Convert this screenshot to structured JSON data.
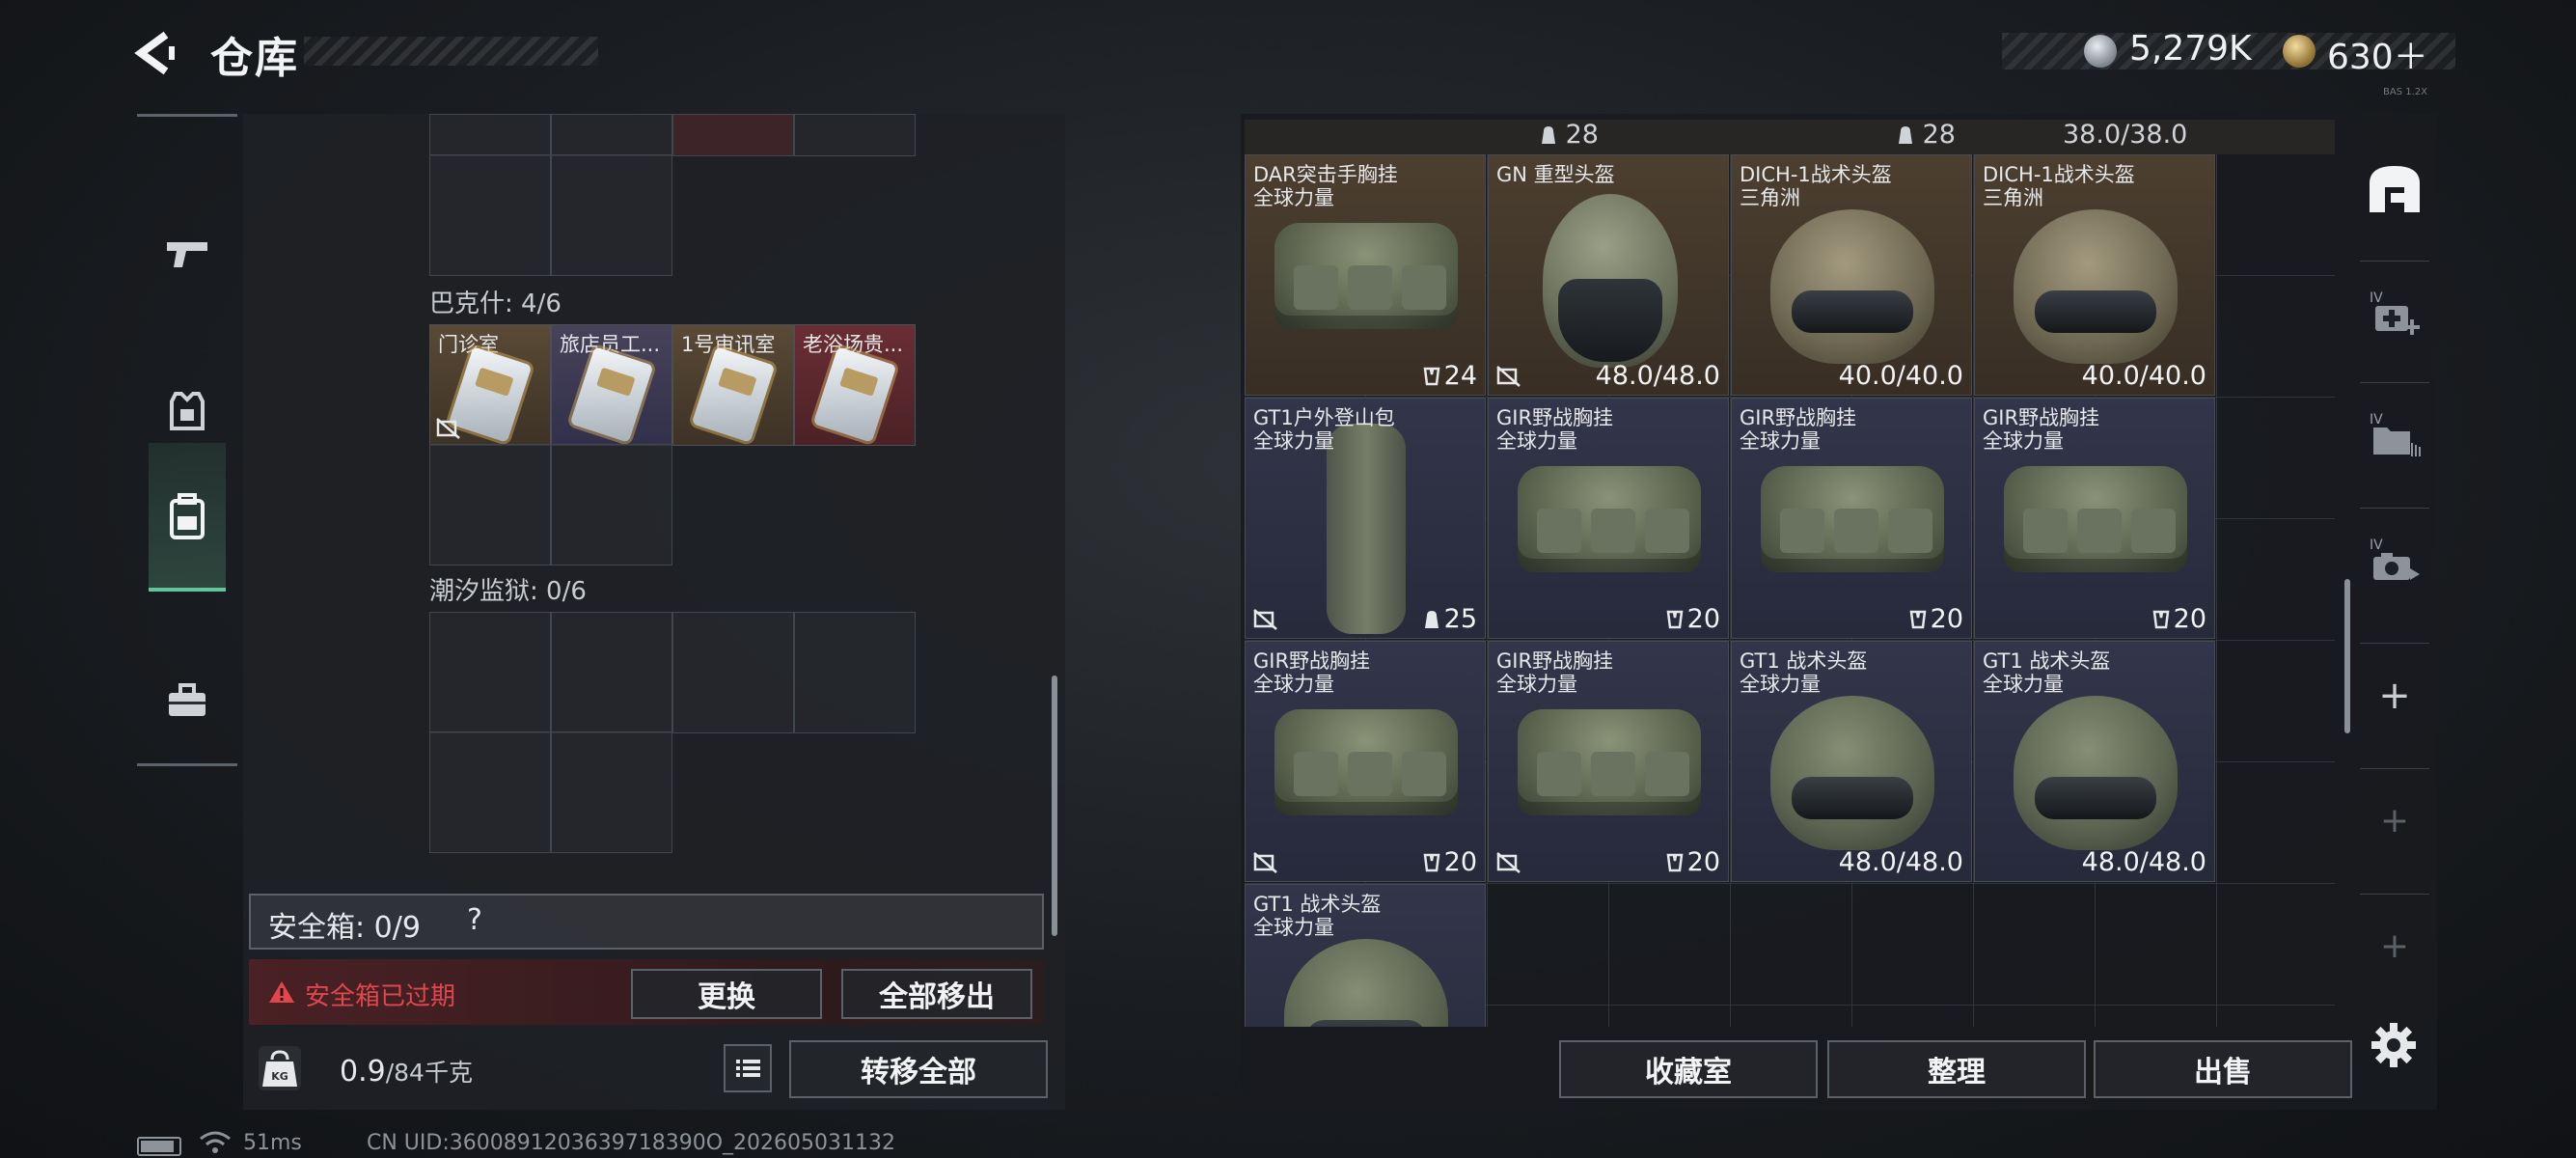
{
  "header": {
    "title": "仓库",
    "currency_silver": "5,279K",
    "currency_gold": "630＋",
    "version_tag": "BAS 1.2X"
  },
  "left_nav": {
    "items": [
      {
        "icon": "pistol-icon"
      },
      {
        "icon": "armor-vest-icon"
      },
      {
        "icon": "backpack-icon",
        "active": true
      },
      {
        "icon": "toolbox-icon"
      }
    ]
  },
  "key_sections": {
    "baksh": {
      "label": "巴克什: 4/6"
    },
    "tide_prison": {
      "label": "潮汐监狱: 0/6"
    }
  },
  "key_cards": [
    {
      "label": "门诊室",
      "tier": "brown"
    },
    {
      "label": "旅店员工...",
      "tier": "purple"
    },
    {
      "label": "1号审讯室",
      "tier": "brown"
    },
    {
      "label": "老浴场贵...",
      "tier": "red"
    }
  ],
  "safebox": {
    "label": "安全箱: 0/9",
    "help": "?",
    "expired_text": "安全箱已过期",
    "replace_label": "更换",
    "remove_all_label": "全部移出"
  },
  "footer_left": {
    "weight_value": "0.9",
    "weight_unit": "/84千克",
    "transfer_all_label": "转移全部"
  },
  "inventory": {
    "top_partial": [
      "28",
      "28",
      "38.0/38.0"
    ],
    "items": [
      {
        "name": "DAR突击手胸挂",
        "sub": "全球力量",
        "value": "24",
        "value_icon": "durability-icon",
        "tier": "brown",
        "pic": "bag"
      },
      {
        "name": "GN 重型头盔",
        "sub": "",
        "value": "48.0/48.0",
        "tier": "brown",
        "pic": "gn",
        "noimport": true
      },
      {
        "name": "DICH-1战术头盔",
        "sub": "三角洲",
        "value": "40.0/40.0",
        "tier": "brown",
        "pic": "helmet"
      },
      {
        "name": "DICH-1战术头盔",
        "sub": "三角洲",
        "value": "40.0/40.0",
        "tier": "brown",
        "pic": "helmet"
      },
      {
        "name": "GT1户外登山包",
        "sub": "全球力量",
        "value": "25",
        "value_icon": "capacity-icon",
        "tier": "blue",
        "pic": "backpack",
        "noimport": true
      },
      {
        "name": "GIR野战胸挂",
        "sub": "全球力量",
        "value": "20",
        "value_icon": "durability-icon",
        "tier": "blue",
        "pic": "bag"
      },
      {
        "name": "GIR野战胸挂",
        "sub": "全球力量",
        "value": "20",
        "value_icon": "durability-icon",
        "tier": "blue",
        "pic": "bag"
      },
      {
        "name": "GIR野战胸挂",
        "sub": "全球力量",
        "value": "20",
        "value_icon": "durability-icon",
        "tier": "blue",
        "pic": "bag"
      },
      {
        "name": "GIR野战胸挂",
        "sub": "全球力量",
        "value": "20",
        "value_icon": "durability-icon",
        "tier": "blue",
        "pic": "bag",
        "noimport": true
      },
      {
        "name": "GIR野战胸挂",
        "sub": "全球力量",
        "value": "20",
        "value_icon": "durability-icon",
        "tier": "blue",
        "pic": "bag",
        "noimport": true
      },
      {
        "name": "GT1 战术头盔",
        "sub": "全球力量",
        "value": "48.0/48.0",
        "tier": "blue",
        "pic": "helmet-green"
      },
      {
        "name": "GT1 战术头盔",
        "sub": "全球力量",
        "value": "48.0/48.0",
        "tier": "blue",
        "pic": "helmet-green"
      },
      {
        "name": "GT1 战术头盔",
        "sub": "全球力量",
        "value": "",
        "tier": "blue",
        "pic": "helmet-green"
      }
    ]
  },
  "right_tabs": [
    {
      "icon": "stash-home-icon"
    },
    {
      "icon": "medkit-expand-icon",
      "badge": "IV"
    },
    {
      "icon": "folder-expand-icon",
      "badge": "IV"
    },
    {
      "icon": "camera-expand-icon",
      "badge": "IV"
    },
    {
      "icon": "add-icon",
      "label": "+"
    },
    {
      "icon": "add-icon",
      "label": "+"
    },
    {
      "icon": "add-icon",
      "label": "+"
    }
  ],
  "footer_right": {
    "collection_label": "收藏室",
    "organize_label": "整理",
    "sell_label": "出售"
  },
  "status_bar": {
    "ping": "51ms",
    "uid": "CN UID:3600891203639718390O_202605031132"
  }
}
